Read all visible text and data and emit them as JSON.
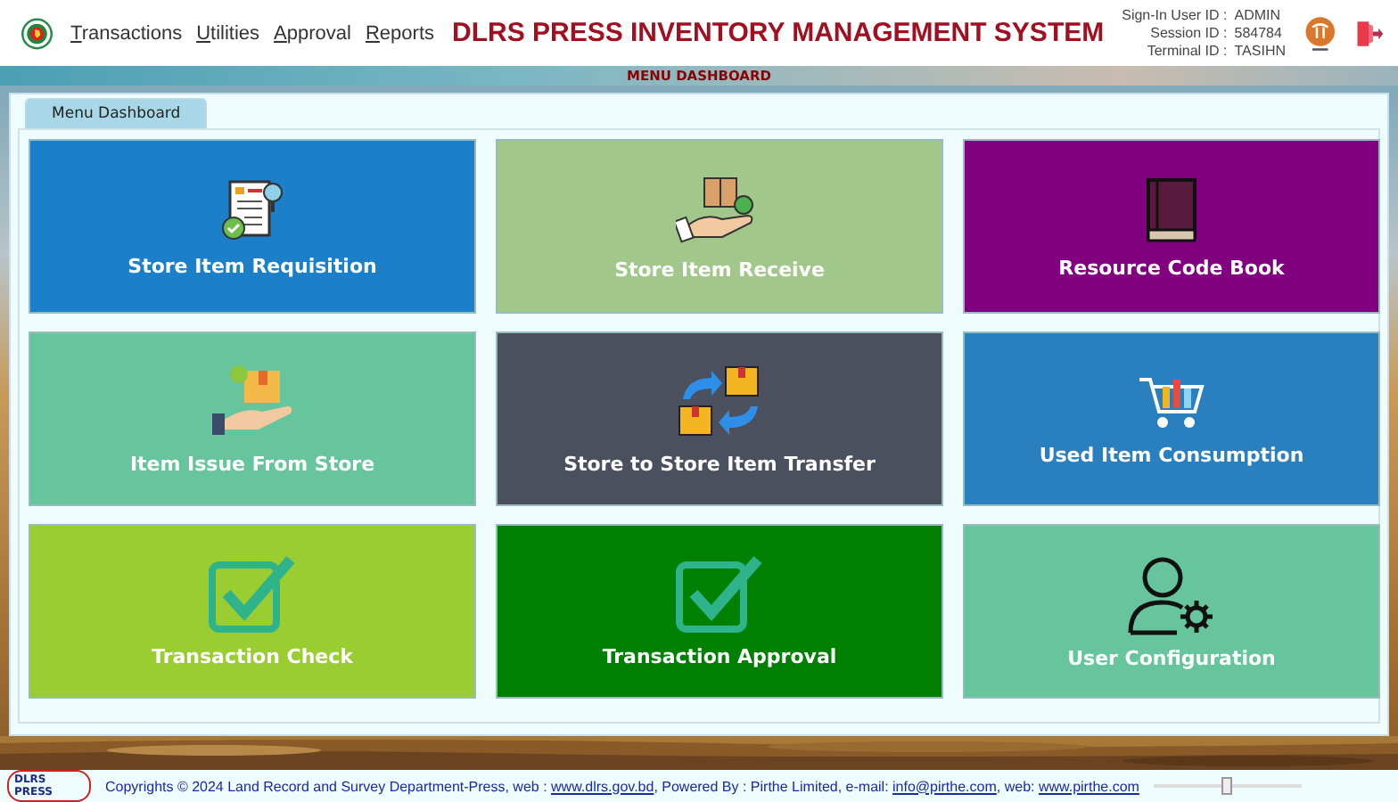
{
  "header": {
    "menu": [
      "Transactions",
      "Utilities",
      "Approval",
      "Reports"
    ],
    "title": "DLRS PRESS INVENTORY MANAGEMENT SYSTEM",
    "session": [
      {
        "label": "Sign-In User ID :",
        "value": "ADMIN"
      },
      {
        "label": "Session ID :",
        "value": "584784"
      },
      {
        "label": "Terminal ID :",
        "value": "TASIHN"
      }
    ]
  },
  "band_title": "MENU DASHBOARD",
  "tabs": [
    {
      "label": "Menu Dashboard",
      "selected": true
    }
  ],
  "tiles": [
    {
      "label": "Store Item Requisition",
      "kind": "requisition",
      "color": "#1b7fc9"
    },
    {
      "label": "Store Item Receive",
      "kind": "receive",
      "color": "#a1c78b"
    },
    {
      "label": "Resource Code Book",
      "kind": "book",
      "color": "#800080"
    },
    {
      "label": "Item Issue From Store",
      "kind": "issue",
      "color": "#66c59d"
    },
    {
      "label": "Store to Store Item Transfer",
      "kind": "transfer",
      "color": "#4a505e"
    },
    {
      "label": "Used Item Consumption",
      "kind": "cart",
      "color": "#2a7fbf"
    },
    {
      "label": "Transaction Check",
      "kind": "check",
      "color": "#9acd32"
    },
    {
      "label": "Transaction Approval",
      "kind": "check",
      "color": "#008000"
    },
    {
      "label": "User Configuration",
      "kind": "user",
      "color": "#66c59d"
    }
  ],
  "footer": {
    "badge": "DLRS PRESS",
    "parts": [
      {
        "text": "Copyrights © 2024 Land Record and Survey Department-Press, web : ",
        "kind": "text"
      },
      {
        "text": "www.dlrs.gov.bd",
        "kind": "link"
      },
      {
        "text": ", Powered By : Pirthe Limited, e-mail: ",
        "kind": "text"
      },
      {
        "text": "info@pirthe.com",
        "kind": "link"
      },
      {
        "text": ", web: ",
        "kind": "text"
      },
      {
        "text": "www.pirthe.com",
        "kind": "link"
      }
    ],
    "zoom_slider": {
      "level": 0.5
    }
  }
}
